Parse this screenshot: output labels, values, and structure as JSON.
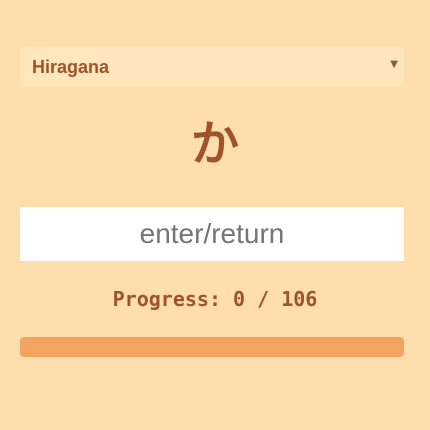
{
  "quiz": {
    "script_select": {
      "selected": "Hiragana",
      "options": [
        "Hiragana"
      ]
    },
    "current_kana": "か",
    "answer_input": {
      "value": "",
      "placeholder": "enter/return"
    },
    "progress": {
      "label": "Progress:",
      "current": 0,
      "total": 106,
      "text": "Progress: 0 / 106",
      "fraction": 0
    }
  },
  "colors": {
    "background": "#ffdead",
    "select_background": "#ffe6bb",
    "text_accent": "#a0522d",
    "progress_track": "#f4a460"
  },
  "icons": {
    "select_arrow": "dropdown-arrow-icon"
  }
}
